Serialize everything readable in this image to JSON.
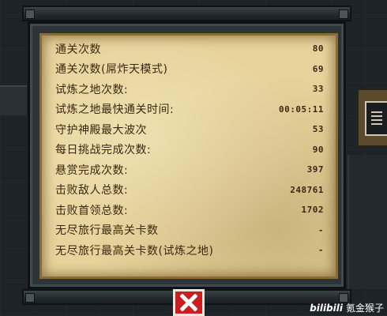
{
  "stats": [
    {
      "label": "通关次数",
      "value": "80"
    },
    {
      "label": "通关次数(屌炸天模式)",
      "value": "69"
    },
    {
      "label": "试炼之地次数:",
      "value": "33"
    },
    {
      "label": "试炼之地最快通关时间:",
      "value": "00:05:11"
    },
    {
      "label": "守护神殿最大波次",
      "value": "53"
    },
    {
      "label": "每日挑战完成次数:",
      "value": "90"
    },
    {
      "label": "悬赏完成次数:",
      "value": "397"
    },
    {
      "label": "击败敌人总数:",
      "value": "248761"
    },
    {
      "label": "击败首领总数:",
      "value": "1702"
    },
    {
      "label": "无尽旅行最高关卡数",
      "value": "-"
    },
    {
      "label": "无尽旅行最高关卡数(试炼之地)",
      "value": "-"
    }
  ],
  "watermark": {
    "logo": "bilibili",
    "author": "氪金猴子"
  },
  "colors": {
    "parchment": "#e6d39b",
    "text": "#3b2710",
    "close_button": "#c9201f",
    "frame": "#2c3437"
  },
  "icons": {
    "close": "close-icon",
    "machine": "machine-panel-icon"
  }
}
